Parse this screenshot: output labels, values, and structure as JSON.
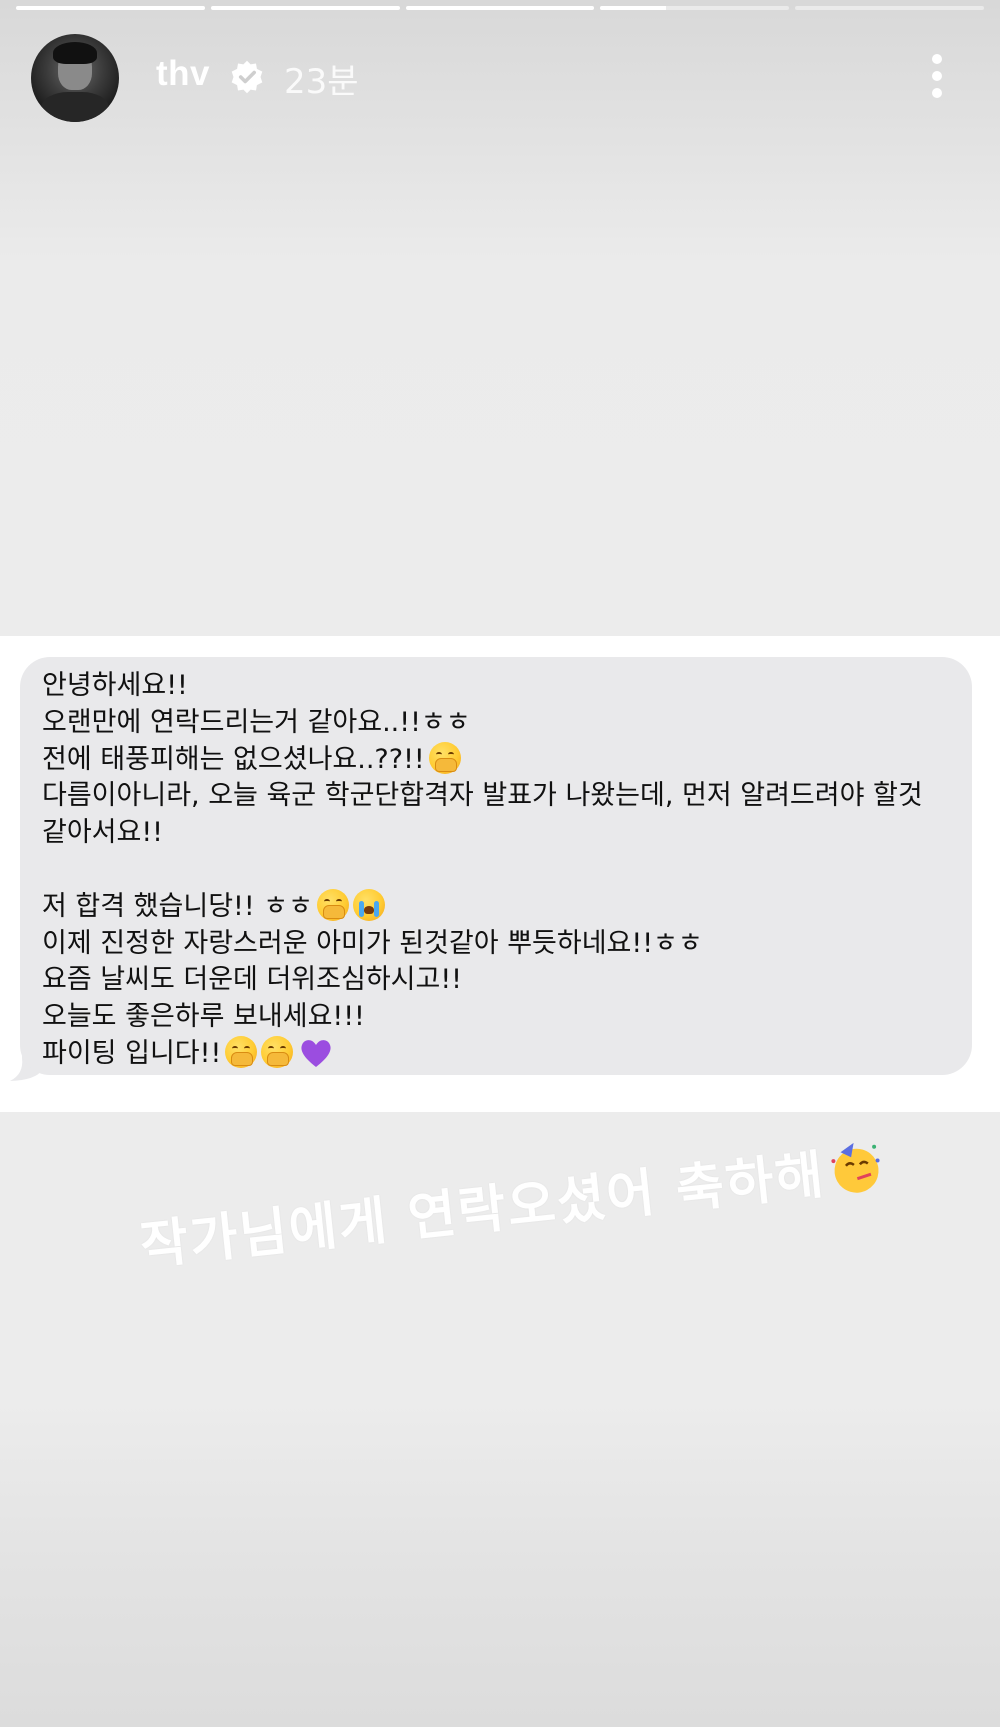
{
  "story": {
    "progress_segments": [
      1,
      1,
      1,
      0.35,
      0
    ],
    "username": "thv",
    "verified": true,
    "time_ago": "23분"
  },
  "message": {
    "lines": [
      "안녕하세요!!",
      "오랜만에 연락드리는거 같아요..!!ㅎㅎ",
      "전에 태풍피해는 없으셨나요..??!!",
      "다름이아니라, 오늘 육군 학군단합격자 발표가 나왔는데, 먼저 알려드려야 할것",
      "같아서요!!",
      "",
      "저 합격 했습니당!! ㅎㅎ",
      "이제 진정한 자랑스러운 아미가 된것같아 뿌듯하네요!!ㅎㅎ",
      "요즘 날씨도 더운데 더위조심하시고!!",
      "오늘도 좋은하루 보내세요!!!",
      "파이팅 입니다!!"
    ],
    "emoji": {
      "line3": "face-with-hand-over-mouth",
      "line7": [
        "face-with-hand-over-mouth",
        "loudly-crying-face"
      ],
      "line11": [
        "face-with-hand-over-mouth",
        "face-with-hand-over-mouth",
        "purple-heart"
      ]
    }
  },
  "caption": {
    "text": "작가님에게 연락오셨어 축하해",
    "emoji": "partying-face"
  },
  "colors": {
    "bubble": "#e9e9eb",
    "card": "#ffffff",
    "heart": "#9b4de0"
  }
}
